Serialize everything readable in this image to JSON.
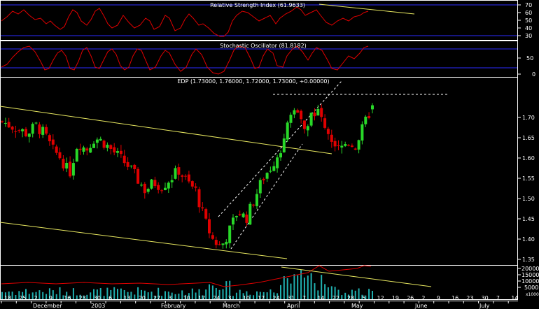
{
  "colors": {
    "background": "#000000",
    "frame": "#ffffff",
    "band": "#2c2cff",
    "indicator": "#e00000",
    "up": "#28d828",
    "down": "#e00000",
    "trendline": "#e8e860",
    "dashed": "#ffffff",
    "volume": "#20b0b0",
    "text": "#ffffff"
  },
  "panels": {
    "rsi": {
      "title": "Relative Strength Index (61.9633)",
      "ticks": [
        "70",
        "60",
        "50",
        "40",
        "30"
      ]
    },
    "stoch": {
      "title": "Stochastic Oscillator (81.8182)",
      "ticks": [
        "50",
        "0"
      ]
    },
    "price": {
      "title": "EDP (1.73000, 1.76000, 1.72000, 1.73000, +0.00000)",
      "ticks": [
        "1.70",
        "1.65",
        "1.60",
        "1.55",
        "1.50",
        "1.45",
        "1.40",
        "1.35"
      ]
    },
    "volume": {
      "ticks": [
        "20000",
        "15000",
        "10000",
        "5000"
      ],
      "unit": "x1000"
    }
  },
  "x_axis": {
    "days": [
      "18",
      "25",
      "2",
      "9",
      "16",
      "23",
      "30",
      "6",
      "13",
      "20",
      "27",
      "3",
      "10",
      "17",
      "24",
      "3",
      "10",
      "17",
      "24",
      "31",
      "7",
      "14",
      "22",
      "28",
      "5",
      "12",
      "19",
      "26",
      "2",
      "9",
      "16",
      "23",
      "30",
      "7",
      "14"
    ],
    "months": [
      "December",
      "2003",
      "February",
      "March",
      "April",
      "May",
      "June",
      "July"
    ]
  },
  "chart_data": {
    "type": "candlestick",
    "title": "EDP (1.73000, 1.76000, 1.72000, 1.73000, +0.00000)",
    "price_range": [
      1.35,
      1.75
    ],
    "date_range": [
      "2002-12-18",
      "2003-07-14"
    ],
    "last_bar": {
      "open": 1.73,
      "high": 1.76,
      "low": 1.72,
      "close": 1.73,
      "change": 0.0
    },
    "close_path": [
      1.69,
      1.68,
      1.67,
      1.66,
      1.68,
      1.66,
      1.62,
      1.6,
      1.56,
      1.64,
      1.62,
      1.65,
      1.64,
      1.62,
      1.6,
      1.58,
      1.55,
      1.52,
      1.54,
      1.53,
      1.55,
      1.57,
      1.54,
      1.52,
      1.45,
      1.4,
      1.38,
      1.42,
      1.47,
      1.45,
      1.5,
      1.55,
      1.58,
      1.62,
      1.68,
      1.73,
      1.68,
      1.72,
      1.7,
      1.65,
      1.62,
      1.64,
      1.63,
      1.68,
      1.73
    ],
    "rsi": {
      "value": 61.9633,
      "bands": [
        70,
        30
      ]
    },
    "stochastic": {
      "value": 81.8182
    },
    "volume_range": [
      0,
      20000
    ]
  }
}
